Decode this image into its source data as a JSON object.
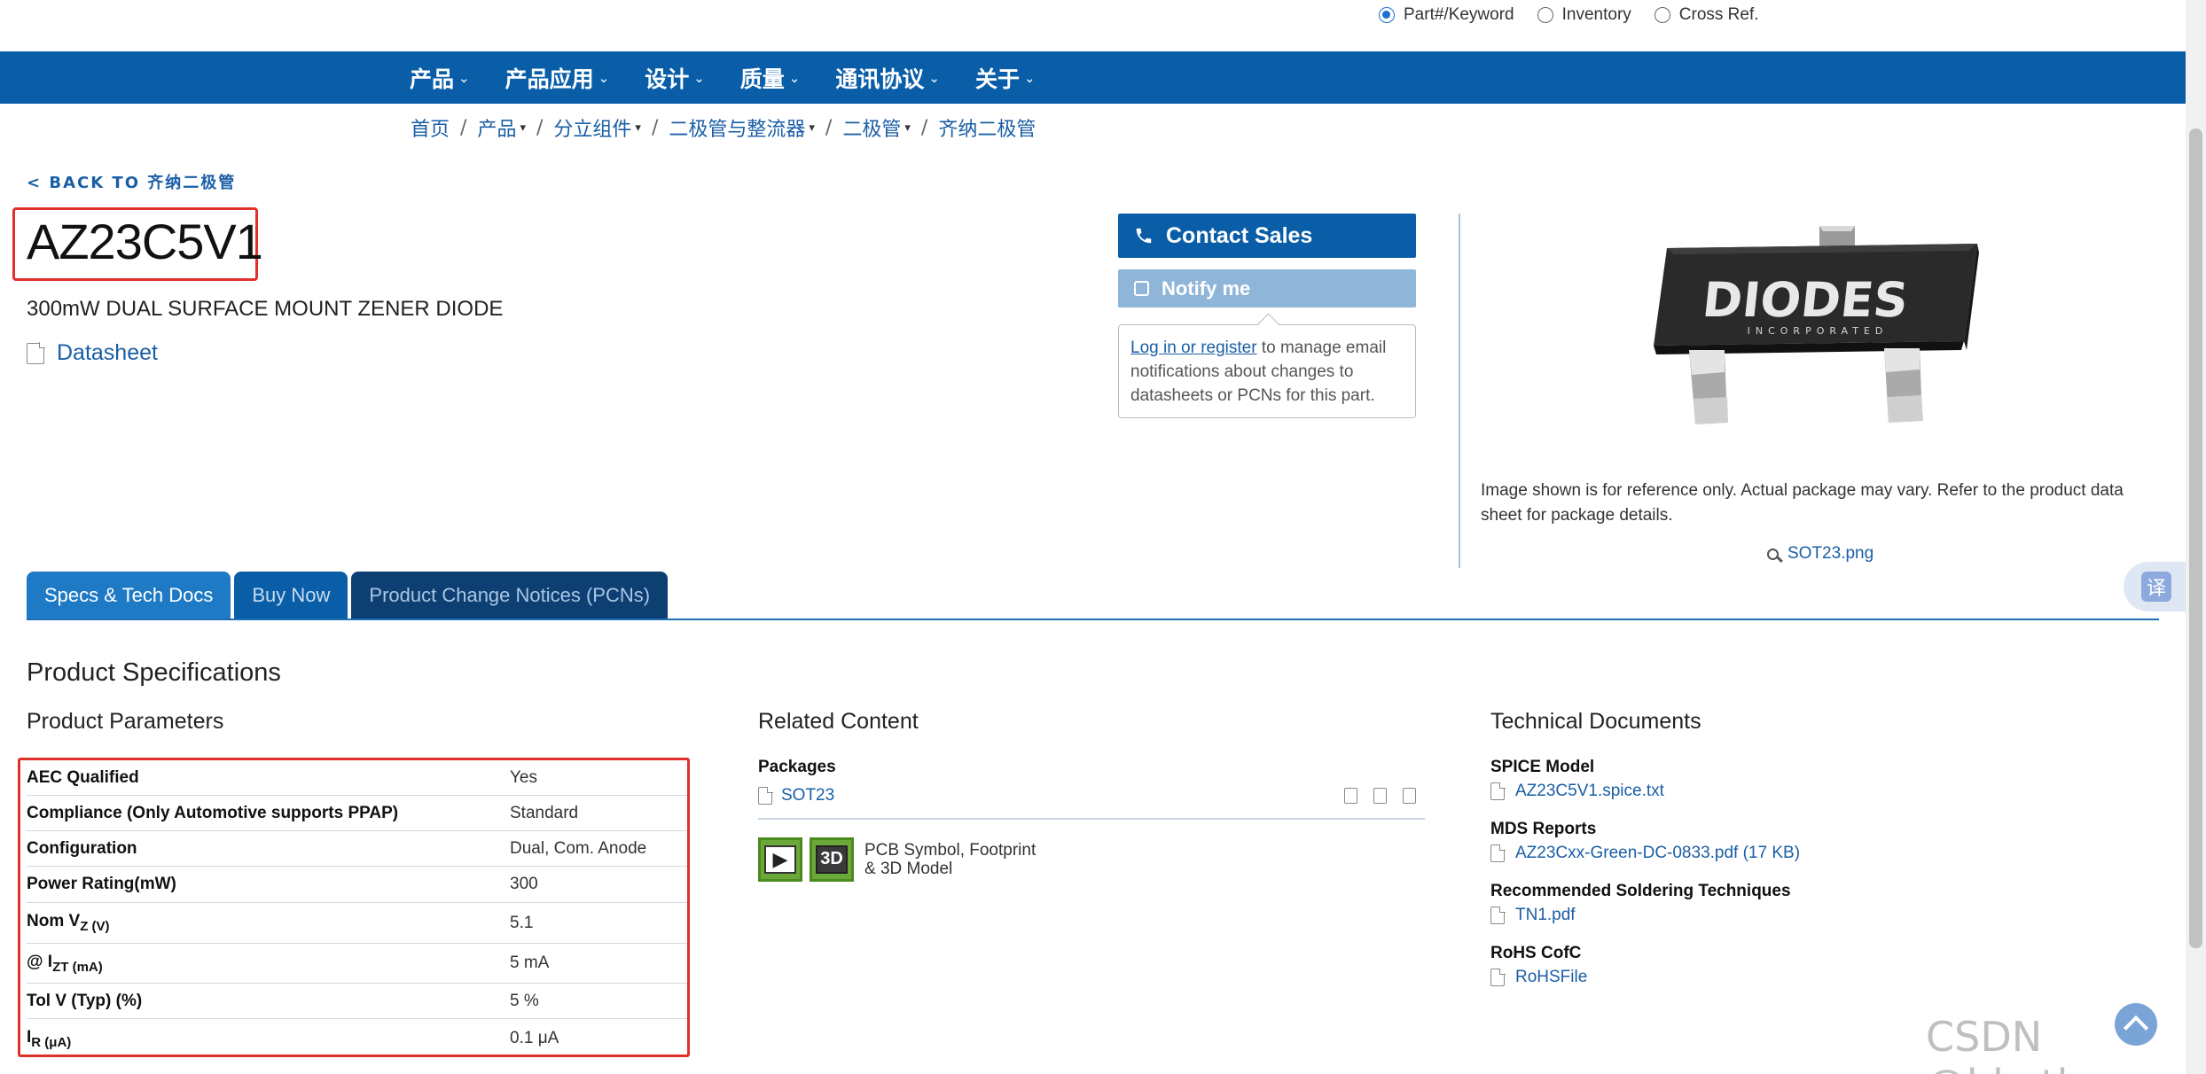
{
  "search_options": [
    {
      "label": "Part#/Keyword",
      "selected": true
    },
    {
      "label": "Inventory",
      "selected": false
    },
    {
      "label": "Cross Ref.",
      "selected": false
    }
  ],
  "nav": {
    "items": [
      "产品",
      "产品应用",
      "设计",
      "质量",
      "通讯协议",
      "关于"
    ]
  },
  "breadcrumb": [
    {
      "label": "首页",
      "dropdown": false
    },
    {
      "label": "产品",
      "dropdown": true
    },
    {
      "label": "分立组件",
      "dropdown": true
    },
    {
      "label": "二极管与整流器",
      "dropdown": true
    },
    {
      "label": "二极管",
      "dropdown": true
    },
    {
      "label": "齐纳二极管",
      "dropdown": false
    }
  ],
  "back_link": "< BACK TO 齐纳二极管",
  "product": {
    "part_number": "AZ23C5V1",
    "description": "300mW DUAL SURFACE MOUNT ZENER DIODE",
    "datasheet_label": "Datasheet"
  },
  "actions": {
    "contact_sales": "Contact Sales",
    "notify_me": "Notify me",
    "notify_link": "Log in or register",
    "notify_text": " to manage email notifications about changes to datasheets or PCNs for this part."
  },
  "image": {
    "brand": "DIODES",
    "brand_sub": "INCORPORATED",
    "caption": "Image shown is for reference only. Actual package may vary. Refer to the product data sheet for package details.",
    "file": "SOT23.png"
  },
  "translate_badge": "译",
  "tabs": [
    "Specs & Tech Docs",
    "Buy Now",
    "Product Change Notices (PCNs)"
  ],
  "specs": {
    "section_title": "Product Specifications",
    "params_title": "Product Parameters",
    "params": [
      {
        "key": "AEC Qualified",
        "value": "Yes"
      },
      {
        "key": "Compliance (Only Automotive supports PPAP)",
        "value": "Standard"
      },
      {
        "key": "Configuration",
        "value": "Dual, Com. Anode"
      },
      {
        "key": "Power Rating(mW)",
        "value": "300"
      },
      {
        "key_main": "Nom V",
        "key_sub": "Z (V)",
        "value": "5.1"
      },
      {
        "key_main": "@ I",
        "key_sub": "ZT (mA)",
        "value": "5 mA"
      },
      {
        "key": "Tol V (Typ) (%)",
        "value": "5 %"
      },
      {
        "key_main": "I",
        "key_sub": "R (μA)",
        "value": "0.1 μA"
      }
    ]
  },
  "related": {
    "title": "Related Content",
    "packages_label": "Packages",
    "package": "SOT23",
    "pcb_line1": "PCB Symbol, Footprint",
    "pcb_line2": "& 3D Model",
    "pcb_3d": "3D"
  },
  "tech_docs": {
    "title": "Technical Documents",
    "items": [
      {
        "heading": "SPICE Model",
        "file": "AZ23C5V1.spice.txt"
      },
      {
        "heading": "MDS Reports",
        "file": "AZ23Cxx-Green-DC-0833.pdf (17 KB)"
      },
      {
        "heading": "Recommended Soldering Techniques",
        "file": "TN1.pdf"
      },
      {
        "heading": "RoHS CofC",
        "file": "RoHSFile"
      }
    ]
  },
  "watermark": "CSDN @hhctlw"
}
